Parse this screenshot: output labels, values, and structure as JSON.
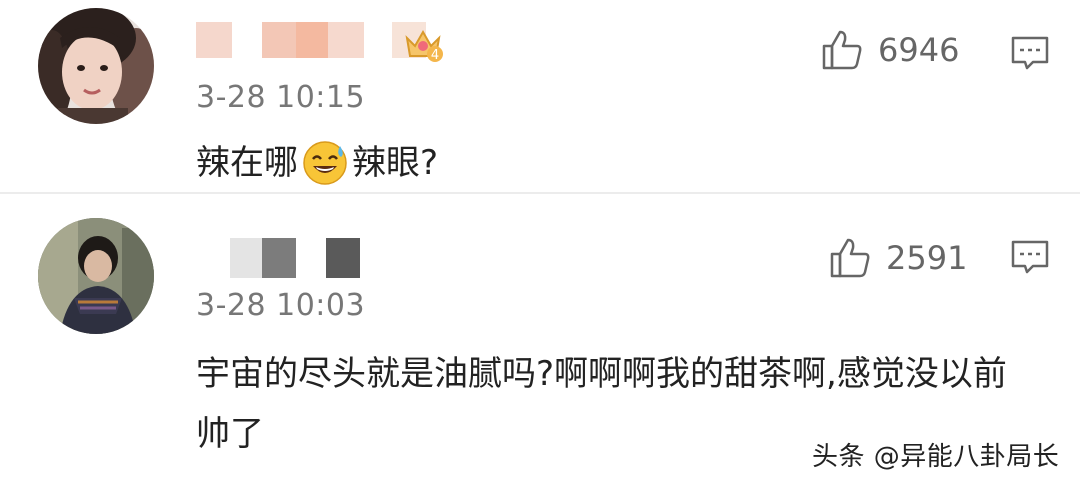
{
  "comments": [
    {
      "time": "3-28 10:15",
      "text_before_emoji": "辣在哪",
      "emoji": "sweat-smile-emoji",
      "text_after_emoji": "辣眼?",
      "likes": "6946",
      "badge": "crown-level-4",
      "badge_level": "4",
      "username_masked": true
    },
    {
      "time": "3-28 10:03",
      "text": "宇宙的尽头就是油腻吗?啊啊啊我的甜茶啊,感觉没以前帅了",
      "likes": "2591",
      "username_masked": true
    }
  ],
  "watermark": "头条 @异能八卦局长",
  "colors": {
    "text": "#222222",
    "meta": "#777777",
    "icon": "#666666",
    "divider": "#ececec"
  }
}
